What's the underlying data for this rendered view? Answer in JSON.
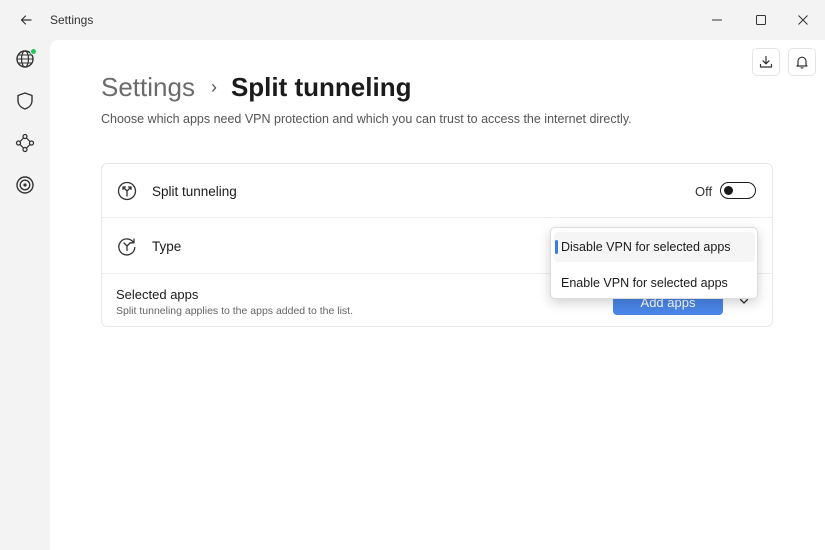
{
  "window": {
    "title": "Settings"
  },
  "breadcrumb": {
    "parent": "Settings",
    "separator": "›",
    "current": "Split tunneling"
  },
  "description": "Choose which apps need VPN protection and which you can trust to access the internet directly.",
  "rows": {
    "split_tunneling": {
      "label": "Split tunneling",
      "state_text": "Off",
      "enabled": false
    },
    "type": {
      "label": "Type"
    },
    "selected_apps": {
      "title": "Selected apps",
      "subtitle": "Split tunneling applies to the apps added to the list.",
      "add_button": "Add apps"
    }
  },
  "dropdown": {
    "options": [
      "Disable VPN for selected apps",
      "Enable VPN for selected apps"
    ],
    "selected_index": 0
  },
  "sidebar": {
    "items": [
      "globe-icon",
      "shield-icon",
      "mesh-network-icon",
      "target-icon"
    ],
    "status_color": "#22c55e"
  },
  "colors": {
    "accent": "#4a86e8",
    "selection_indicator": "#3b7ddd"
  }
}
